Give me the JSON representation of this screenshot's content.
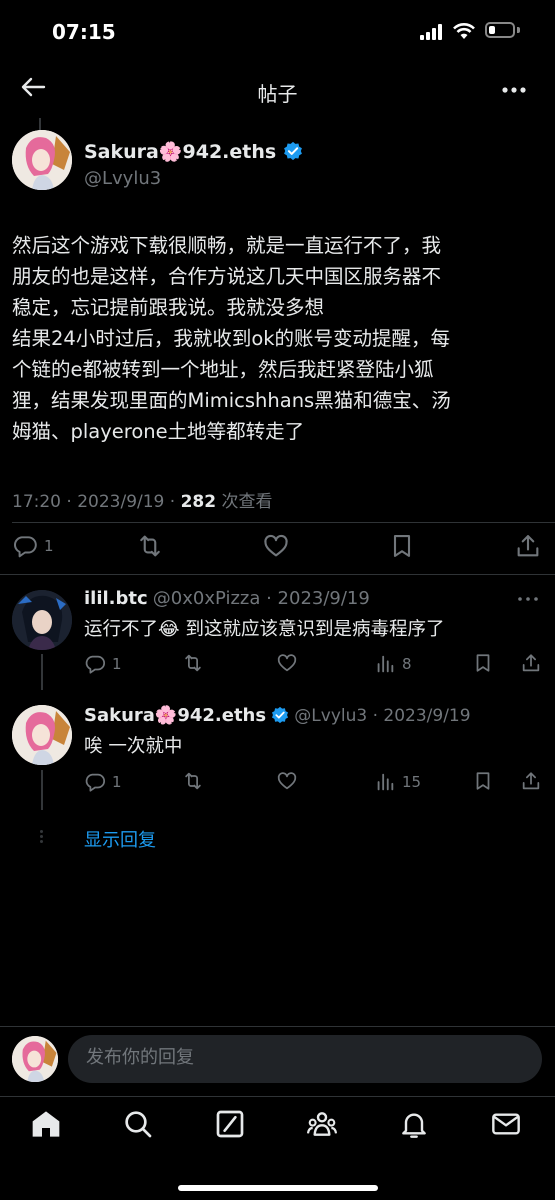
{
  "status_bar": {
    "time": "07:15"
  },
  "header": {
    "title": "帖子"
  },
  "post": {
    "display_name": "Sakura🌸942.eths",
    "handle": "@Lvylu3",
    "lines": [
      "然后这个游戏下载很顺畅，就是一直运行不了，我",
      "朋友的也是这样，合作方说这几天中国区服务器不",
      "稳定，忘记提前跟我说。我就没多想",
      "结果24小时过后，我就收到ok的账号变动提醒，每",
      "个链的e都被转到一个地址，然后我赶紧登陆小狐",
      "狸，结果发现里面的Mimicshhans黑猫和德宝、汤",
      "姆猫、playerone土地等都转走了"
    ],
    "timestamp": "17:20 · 2023/9/19 · ",
    "views_count": "282",
    "views_label": " 次查看",
    "reply_count": "1"
  },
  "replies": [
    {
      "display_name": "ilil.btc",
      "handle_date": "@0x0xPizza · 2023/9/19",
      "text": "运行不了😂 到这就应该意识到是病毒程序了",
      "reply_count": "1",
      "views": "8"
    },
    {
      "display_name": "Sakura🌸942.eths",
      "handle_date": "@Lvylu3 · 2023/9/19",
      "text": "唉 一次就中",
      "reply_count": "1",
      "views": "15"
    }
  ],
  "show_replies": "显示回复",
  "compose": {
    "placeholder": "发布你的回复"
  },
  "colors": {
    "accent": "#1d9bf0",
    "muted": "#71767b",
    "text": "#e7e9ea",
    "background": "#000000"
  },
  "icons": [
    "back-arrow-icon",
    "more-icon",
    "verified-badge-icon",
    "reply-icon",
    "retweet-icon",
    "like-icon",
    "bookmark-icon",
    "share-icon",
    "views-icon",
    "home-icon",
    "search-icon",
    "grok-icon",
    "communities-icon",
    "notifications-icon",
    "messages-icon"
  ]
}
